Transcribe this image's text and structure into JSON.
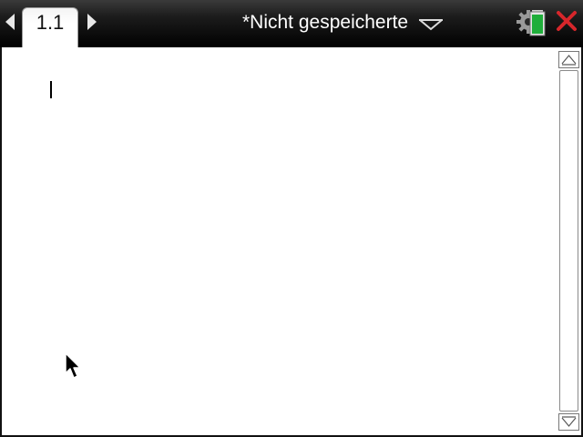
{
  "tabs": [
    {
      "label": "1.1"
    }
  ],
  "document": {
    "title": "*Nicht gespeicherte"
  },
  "colors": {
    "titlebar": "#000000",
    "battery_green": "#1fae3a",
    "close_red": "#d7262b",
    "work_area": "#ffffff"
  },
  "icons": {
    "nav_left": "triangle-left-icon",
    "nav_right": "triangle-right-icon",
    "title_dropdown": "chevron-down-icon",
    "settings_battery": "gear-battery-icon",
    "close": "close-icon",
    "scroll_up": "chevron-up-icon",
    "scroll_down": "chevron-down-icon",
    "pointer": "mouse-pointer-icon"
  }
}
